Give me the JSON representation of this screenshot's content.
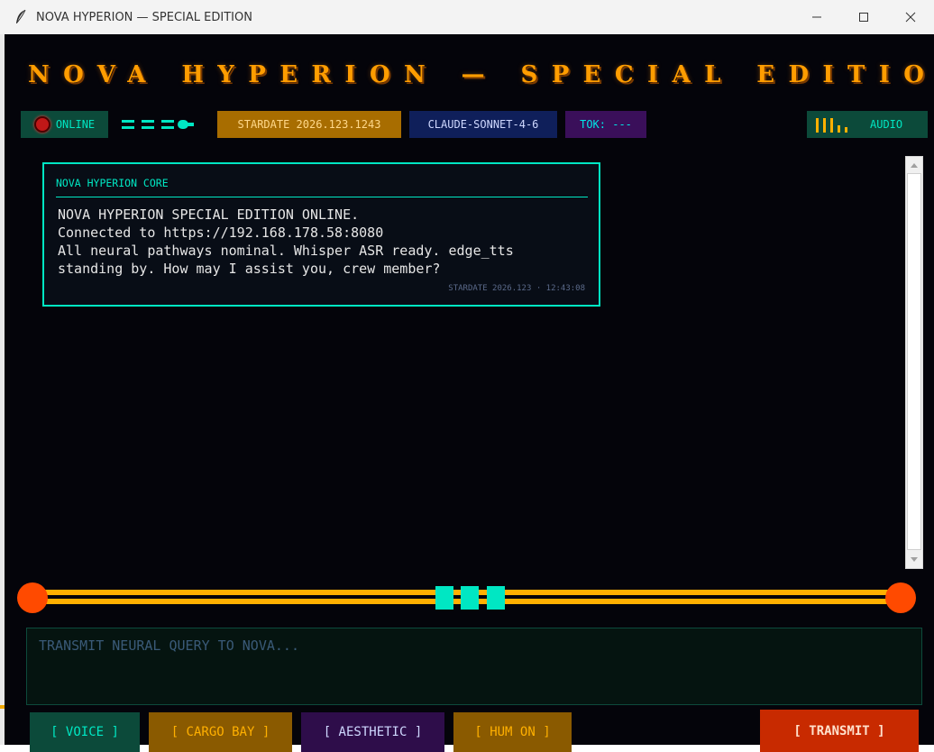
{
  "window": {
    "title": "NOVA HYPERION — SPECIAL EDITION",
    "app_icon": "feather-icon",
    "controls": [
      "minimize-icon",
      "maximize-icon",
      "close-icon"
    ]
  },
  "header": {
    "title": "NOVA HYPERION — SPECIAL EDITION"
  },
  "status": {
    "online_label": "ONLINE",
    "stardate": "STARDATE 2026.123.1243",
    "model": "CLAUDE-SONNET-4-6",
    "tokens": "TOK: ---",
    "audio_label": "AUDIO"
  },
  "messages": [
    {
      "sender": "NOVA HYPERION CORE",
      "text": "NOVA HYPERION SPECIAL EDITION ONLINE.\nConnected to https://192.168.178.58:8080\nAll neural pathways nominal. Whisper ASR ready. edge_tts\nstanding by. How may I assist you, crew member?",
      "stamp": "STARDATE 2026.123 · 12:43:08"
    }
  ],
  "input": {
    "placeholder": "TRANSMIT NEURAL QUERY TO NOVA...",
    "value": ""
  },
  "buttons": {
    "voice": "[ VOICE ]",
    "cargo_bay": "[ CARGO BAY ]",
    "aesthetic": "[ AESTHETIC ]",
    "hum": "[ HUM ON ]",
    "transmit": "[ TRANSMIT ]"
  },
  "colors": {
    "background": "#04040a",
    "accent_teal": "#00e7c3",
    "accent_orange": "#ff9d00",
    "accent_red": "#ff4400",
    "amber": "#ffb000"
  }
}
